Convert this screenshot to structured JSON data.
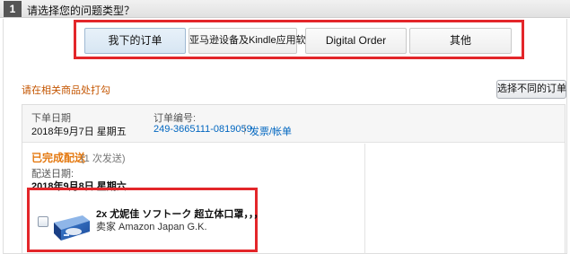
{
  "step": {
    "number": "1",
    "title": "请选择您的问题类型？"
  },
  "tabs": [
    {
      "label": "我下的订单",
      "active": true
    },
    {
      "label": "亚马逊设备及Kindle应用软件",
      "active": false
    },
    {
      "label": "Digital Order",
      "active": false
    },
    {
      "label": "其他",
      "active": false
    }
  ],
  "hint": "请在相关商品处打勾",
  "select_different_order": "选择不同的订单",
  "order": {
    "date_label": "下单日期",
    "date_value": "2018年9月7日 星期五",
    "number_label": "订单编号:",
    "number_value": "249-3665111-0819059",
    "separator": "|",
    "invoice_link": "发票/帐单",
    "status": "已完成配送",
    "status_sub": "(1 次发送)",
    "delivery_label": "配送日期:",
    "delivery_value": "2018年9月8日 星期六"
  },
  "item": {
    "title": "2x 尤妮佳 ソフトーク 超立体口罩，，，",
    "seller": "卖家 Amazon Japan G.K."
  },
  "colors": {
    "highlight_red": "#e3262a",
    "status_orange": "#e47911",
    "hint_orange": "#c45500",
    "link_blue": "#0066c0",
    "active_tab": "#d7e6f3"
  },
  "icons": [
    "checkbox",
    "product-image"
  ]
}
